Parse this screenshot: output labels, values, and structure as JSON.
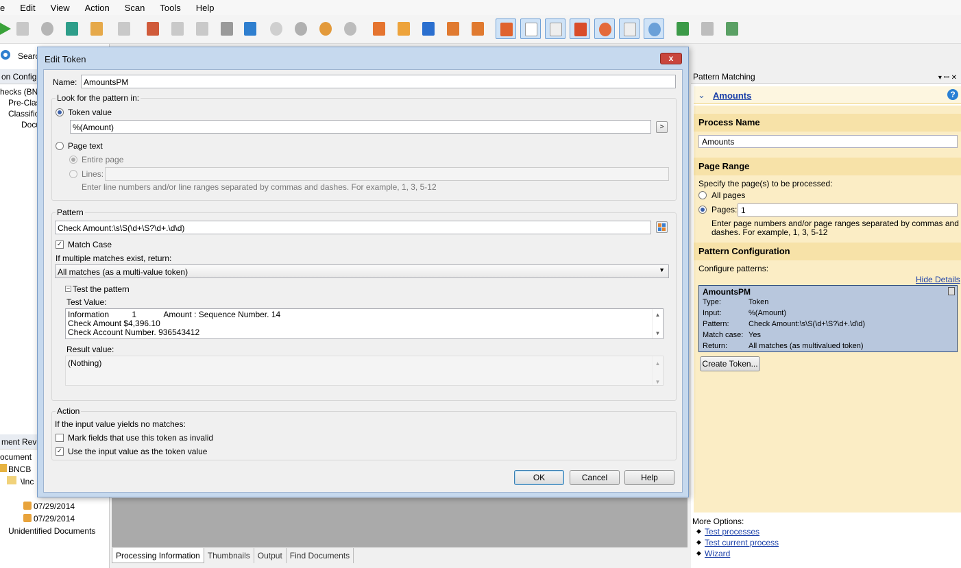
{
  "menu": [
    "e",
    "Edit",
    "View",
    "Action",
    "Scan",
    "Tools",
    "Help"
  ],
  "left_panel": {
    "search_label": "Search",
    "config_header": "on Configu",
    "tree": [
      "hecks (BNC",
      "Pre-Class",
      "Classifica",
      "Docu"
    ],
    "review_header": "ment Revi",
    "review_tree": [
      "ocument",
      "BNCB",
      "\\Inc",
      "07/29/2014",
      "07/29/2014",
      "Unidentified Documents"
    ]
  },
  "bottom_tabs": [
    "Processing Information",
    "Thumbnails",
    "Output",
    "Find Documents"
  ],
  "dialog": {
    "title": "Edit Token",
    "close_label": "x",
    "name_label": "Name:",
    "name_value": "AmountsPM",
    "look_group": "Look for the pattern in:",
    "token_value_label": "Token value",
    "token_value": "%(Amount)",
    "token_btn": ">",
    "page_text_label": "Page text",
    "entire_page_label": "Entire page",
    "lines_label": "Lines:",
    "lines_hint": "Enter line numbers and/or line ranges separated by commas and dashes.  For example, 1, 3, 5-12",
    "pattern_group": "Pattern",
    "pattern_value": "Check Amount:\\s\\S(\\d+\\S?\\d+.\\d\\d)",
    "match_case_label": "Match Case",
    "match_case": true,
    "multiple_label": "If multiple matches exist, return:",
    "multiple_value": "All matches (as a multi-value token)",
    "test_header": "Test the pattern",
    "test_value_label": "Test Value:",
    "test_lines": [
      "Information          1            Amount : Sequence Number. 14",
      "Check Amount $4,396.10",
      "Check Account Number. 936543412"
    ],
    "result_label": "Result value:",
    "result_value": "(Nothing)",
    "action_group": "Action",
    "no_match_label": "If the input value yields no matches:",
    "mark_invalid_label": "Mark fields that use this token as invalid",
    "use_input_label": "Use the input value as the token value",
    "ok": "OK",
    "cancel": "Cancel",
    "help": "Help"
  },
  "right_panel": {
    "header": "Pattern Matching",
    "pin": "▾ ꟷ ✕",
    "section_title": "Amounts",
    "process_name_title": "Process Name",
    "process_name_value": "Amounts",
    "page_range_title": "Page Range",
    "page_range_desc": "Specify the page(s) to be processed:",
    "all_pages": "All pages",
    "pages_label": "Pages:",
    "pages_value": "1",
    "pages_hint_1": "Enter page numbers and/or page ranges separated by commas and",
    "pages_hint_2": "dashes.  For example, 1, 3, 5-12",
    "pattern_config_title": "Pattern Configuration",
    "configure_label": "Configure patterns:",
    "hide_details": "Hide Details",
    "detail_name": "AmountsPM",
    "detail_rows": [
      {
        "k": "Type:",
        "v": "Token"
      },
      {
        "k": "Input:",
        "v": "%(Amount)"
      },
      {
        "k": "Pattern:",
        "v": "Check Amount:\\s\\S(\\d+\\S?\\d+.\\d\\d)"
      },
      {
        "k": "Match case:",
        "v": "Yes"
      },
      {
        "k": "Return:",
        "v": "All matches (as multivalued token)"
      }
    ],
    "create_token": "Create Token...",
    "more_options": "More Options:",
    "links": [
      "Test processes",
      "Test current process",
      "Wizard"
    ]
  },
  "colors": {
    "accent": "#3a5fa8",
    "panel_bg": "#fbedc5",
    "section_bg": "#f7e2a8"
  }
}
